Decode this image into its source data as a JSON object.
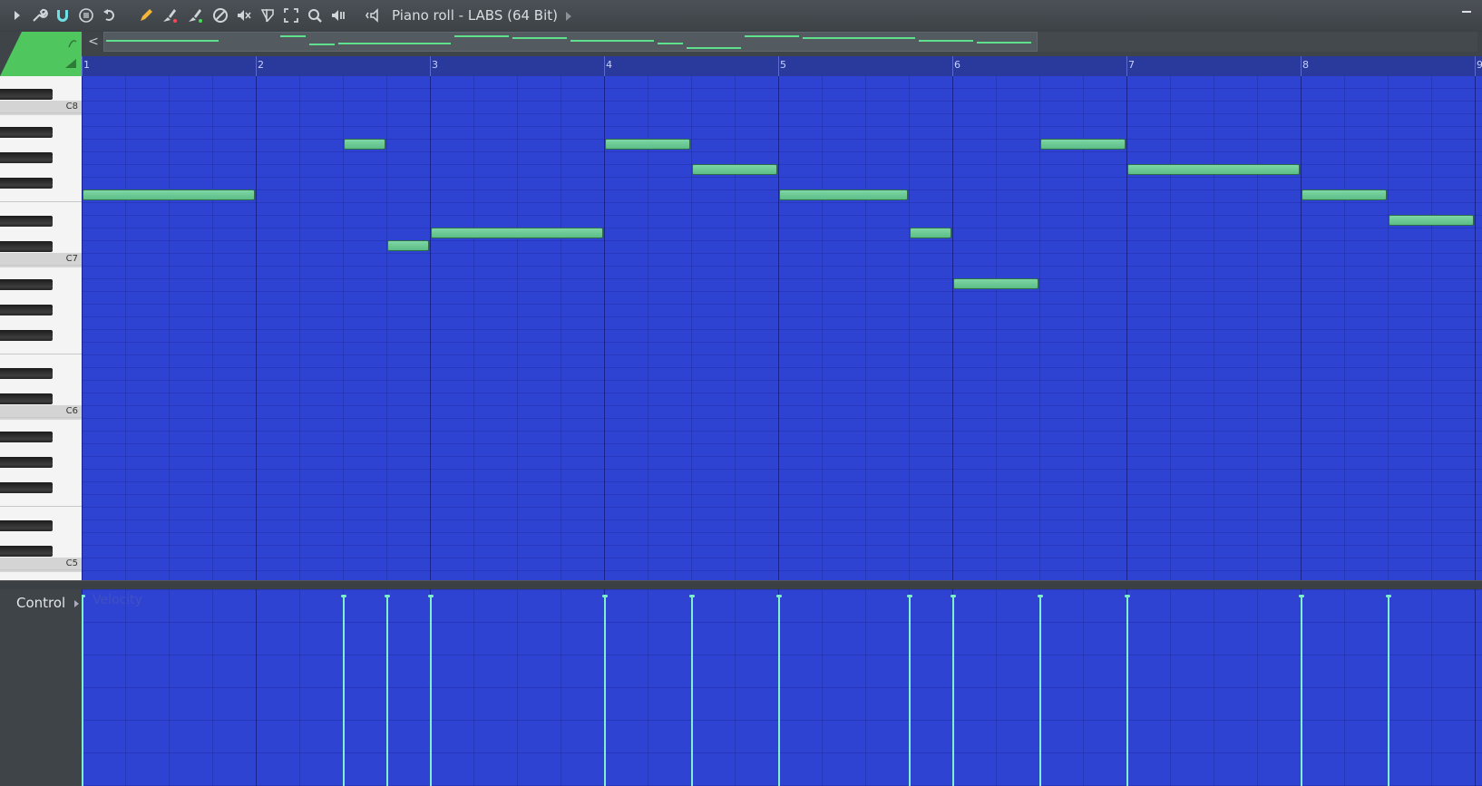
{
  "window": {
    "title": "Piano roll - LABS (64 Bit)"
  },
  "toolbar": {
    "icons": [
      "play-arrow-icon",
      "wrench-icon",
      "magnet-icon",
      "menu-circle-icon",
      "undo-icon",
      "pencil-icon",
      "paint-brush-icon",
      "paint-brush-alt-icon",
      "delete-icon",
      "mute-icon",
      "slice-icon",
      "select-icon",
      "zoom-icon",
      "playback-icon",
      "speaker-icon"
    ]
  },
  "ruler": {
    "bars": [
      "1",
      "2",
      "3",
      "4",
      "5",
      "6",
      "7",
      "8",
      "9"
    ]
  },
  "keyboard": {
    "octave_labels": [
      "C8",
      "C7",
      "C6"
    ]
  },
  "control": {
    "label": "Control",
    "target": "Velocity"
  },
  "colors": {
    "grid_bg": "#2f43d3",
    "note": "#6ccb96",
    "velocity": "#7ff0c8",
    "accent_green": "#5fe08c"
  },
  "notes": [
    {
      "pitch": "F7",
      "start": 1.0,
      "length": 1.0
    },
    {
      "pitch": "A7",
      "start": 2.5,
      "length": 0.25
    },
    {
      "pitch": "C#7",
      "start": 2.75,
      "length": 0.25
    },
    {
      "pitch": "D7",
      "start": 3.0,
      "length": 1.0
    },
    {
      "pitch": "A7",
      "start": 4.0,
      "length": 0.5
    },
    {
      "pitch": "G7",
      "start": 4.5,
      "length": 0.5
    },
    {
      "pitch": "F7",
      "start": 5.0,
      "length": 0.75
    },
    {
      "pitch": "D7",
      "start": 5.75,
      "length": 0.25
    },
    {
      "pitch": "A#6",
      "start": 6.0,
      "length": 0.5
    },
    {
      "pitch": "A7",
      "start": 6.5,
      "length": 0.5
    },
    {
      "pitch": "G7",
      "start": 7.0,
      "length": 1.0
    },
    {
      "pitch": "F7",
      "start": 8.0,
      "length": 0.5
    },
    {
      "pitch": "D#7",
      "start": 8.5,
      "length": 0.5
    }
  ]
}
